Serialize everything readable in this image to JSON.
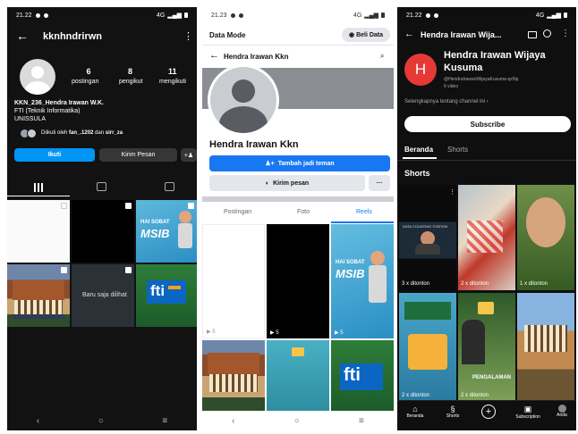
{
  "phone1": {
    "status": {
      "time": "21.22",
      "right": "4G"
    },
    "header": {
      "username": "kknhndrirwn"
    },
    "stats": [
      {
        "value": "6",
        "label": "postingan"
      },
      {
        "value": "8",
        "label": "pengikut"
      },
      {
        "value": "11",
        "label": "mengikuti"
      }
    ],
    "bio": {
      "name": "KKN_236_Hendra Irawan W.K.",
      "line2": "FTI (Teknik Informatika)",
      "line3": "UNISSULA",
      "followed_by_prefix": "Diikuti oleh ",
      "followed_by_names": "fan_.1202",
      "followed_by_mid": " dan ",
      "followed_by_last": "sirr_za"
    },
    "buttons": {
      "follow": "Ikuti",
      "message": "Kirim Pesan"
    },
    "overlay_text": "Baru saja dilihat",
    "tile_texts": {
      "hai": "HAI SOBAT",
      "msib": "MSIB",
      "fti": "fti"
    }
  },
  "phone2": {
    "status": {
      "time": "21.23",
      "right": "4G"
    },
    "topbar": {
      "title": "Data Mode",
      "buy": "Beli Data"
    },
    "header": {
      "title": "Hendra Irawan Kkn"
    },
    "profile_name": "Hendra Irawan Kkn",
    "buttons": {
      "add_friend": "Tambah jadi teman",
      "message": "Kirim pesan",
      "more": "···"
    },
    "tabs": [
      "Postingan",
      "Foto",
      "Reels"
    ],
    "reel_counts": [
      "5",
      "5",
      "5"
    ],
    "tile_texts": {
      "hai": "HAI SOBAT",
      "msib": "MSIB",
      "fti": "fti"
    }
  },
  "phone3": {
    "status": {
      "time": "21.22",
      "right": "4G"
    },
    "header": {
      "title": "Hendra Irawan Wija..."
    },
    "channel": {
      "avatar_letter": "H",
      "name_line1": "Hendra Irawan Wijaya",
      "name_line2": "Kusuma",
      "handle": "@HendraIrawanWijayaKusuma-qz5lp",
      "videos": "6 video",
      "more": "Selengkapnya tentang channel ini"
    },
    "subscribe": "Subscribe",
    "tabs": [
      "Beranda",
      "Shorts"
    ],
    "section": "Shorts",
    "shorts": [
      {
        "views": "3 x ditonton"
      },
      {
        "views": "2 x ditonton"
      },
      {
        "views": "1 x ditonton"
      },
      {
        "views": "2 x ditonton"
      },
      {
        "views": "2 x ditonton"
      },
      {
        "views": ""
      }
    ],
    "tile_texts": {
      "pengalaman": "PENGALAMAN",
      "data": "DATA COUNTING STATION"
    },
    "bottom_nav": [
      "Beranda",
      "Shorts",
      "",
      "Subscription",
      "Anda"
    ]
  },
  "colors": {
    "ig_blue": "#0095f6",
    "fb_blue": "#1877f2",
    "yt_red": "#ff0000"
  }
}
